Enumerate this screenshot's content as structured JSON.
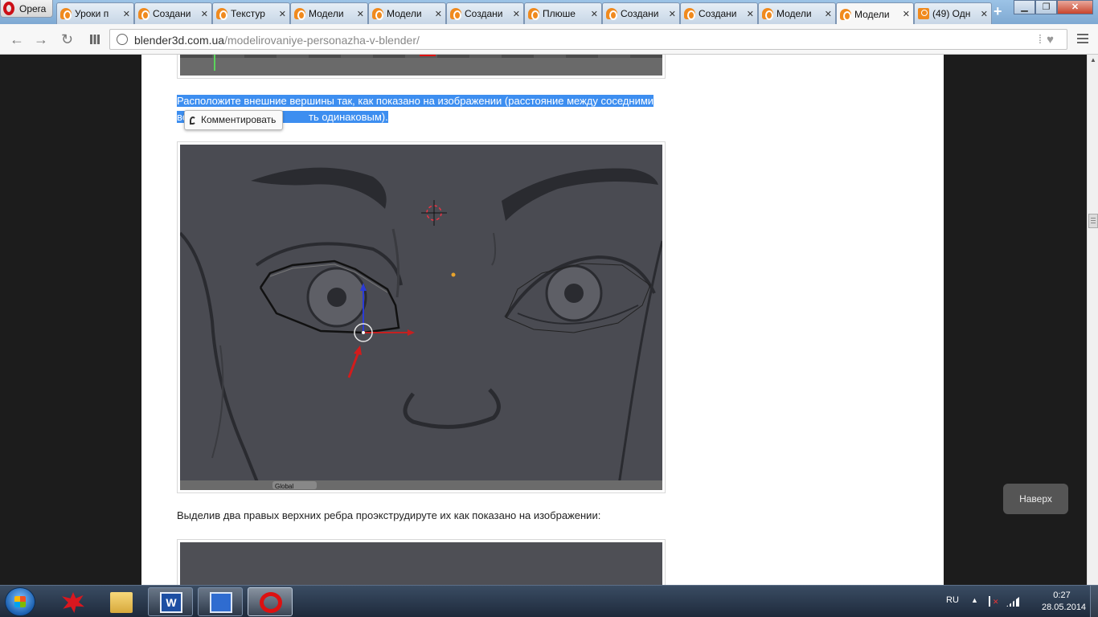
{
  "browser": {
    "menu_label": "Opera",
    "tabs": [
      {
        "label": "Уроки п",
        "icon": "blender-icon"
      },
      {
        "label": "Создани",
        "icon": "blender-icon"
      },
      {
        "label": "Текстур",
        "icon": "blender-icon"
      },
      {
        "label": "Модели",
        "icon": "blender-icon"
      },
      {
        "label": "Модели",
        "icon": "blender-icon"
      },
      {
        "label": "Создани",
        "icon": "blender-icon"
      },
      {
        "label": "Плюше",
        "icon": "blender-icon"
      },
      {
        "label": "Создани",
        "icon": "blender-icon"
      },
      {
        "label": "Создани",
        "icon": "blender-icon"
      },
      {
        "label": "Модели",
        "icon": "blender-icon"
      },
      {
        "label": "Модели",
        "icon": "blender-icon",
        "active": true
      },
      {
        "label": "(49) Одн",
        "icon": "odnoklassniki-icon"
      }
    ],
    "new_tab_label": "+",
    "url_host": "blender3d.com.ua",
    "url_path": "/modelirovaniye-personazha-v-blender/"
  },
  "page": {
    "selected_paragraph_line1": "Расположите внешние вершины так, как показано на изображении (расстояние между соседними",
    "selected_paragraph_line2_start": "ве",
    "selected_paragraph_line2_end": "ть одинаковым).",
    "tooltip_label": "Комментировать",
    "figure_toolbar_mode": "Global",
    "paragraph2": "Выделив два правых верхних ребра проэкструдируте их как показано на изображении:",
    "back_to_top_label": "Наверх"
  },
  "taskbar": {
    "language": "RU",
    "time": "0:27",
    "date": "28.05.2014",
    "apps": [
      "paint-splash-app",
      "explorer-app",
      "word-app",
      "save-app",
      "opera-app"
    ]
  },
  "colors": {
    "selection": "#3d8ef0",
    "opera_red": "#cc0f16",
    "blender_orange": "#f08a1e"
  }
}
